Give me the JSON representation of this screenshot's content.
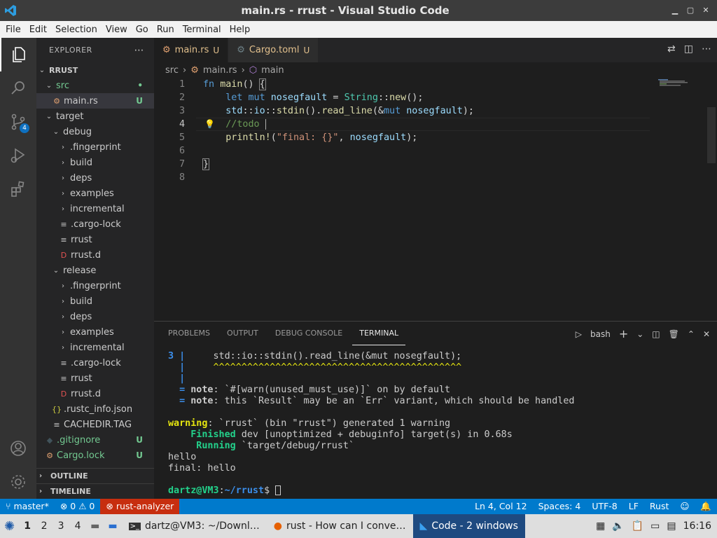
{
  "window": {
    "title": "main.rs - rrust - Visual Studio Code"
  },
  "menu": [
    "File",
    "Edit",
    "Selection",
    "View",
    "Go",
    "Run",
    "Terminal",
    "Help"
  ],
  "activity": {
    "scm_badge": "4"
  },
  "explorer": {
    "header": "EXPLORER",
    "root": "RRUST",
    "items": [
      {
        "label": "src",
        "indent": 1,
        "type": "folder-open",
        "green": true,
        "tag": "•"
      },
      {
        "label": "main.rs",
        "indent": 2,
        "type": "file",
        "green": false,
        "tag": "U",
        "selected": true
      },
      {
        "label": "target",
        "indent": 1,
        "type": "folder-open"
      },
      {
        "label": "debug",
        "indent": 2,
        "type": "folder-open"
      },
      {
        "label": ".fingerprint",
        "indent": 3,
        "type": "folder"
      },
      {
        "label": "build",
        "indent": 3,
        "type": "folder"
      },
      {
        "label": "deps",
        "indent": 3,
        "type": "folder"
      },
      {
        "label": "examples",
        "indent": 3,
        "type": "folder"
      },
      {
        "label": "incremental",
        "indent": 3,
        "type": "folder"
      },
      {
        "label": ".cargo-lock",
        "indent": 3,
        "type": "lines"
      },
      {
        "label": "rrust",
        "indent": 3,
        "type": "lines"
      },
      {
        "label": "rrust.d",
        "indent": 3,
        "type": "d"
      },
      {
        "label": "release",
        "indent": 2,
        "type": "folder-open"
      },
      {
        "label": ".fingerprint",
        "indent": 3,
        "type": "folder"
      },
      {
        "label": "build",
        "indent": 3,
        "type": "folder"
      },
      {
        "label": "deps",
        "indent": 3,
        "type": "folder"
      },
      {
        "label": "examples",
        "indent": 3,
        "type": "folder"
      },
      {
        "label": "incremental",
        "indent": 3,
        "type": "folder"
      },
      {
        "label": ".cargo-lock",
        "indent": 3,
        "type": "lines"
      },
      {
        "label": "rrust",
        "indent": 3,
        "type": "lines"
      },
      {
        "label": "rrust.d",
        "indent": 3,
        "type": "d"
      },
      {
        "label": ".rustc_info.json",
        "indent": 2,
        "type": "json"
      },
      {
        "label": "CACHEDIR.TAG",
        "indent": 2,
        "type": "lines"
      },
      {
        "label": ".gitignore",
        "indent": 1,
        "type": "git",
        "green": true,
        "tag": "U"
      },
      {
        "label": "Cargo.lock",
        "indent": 1,
        "type": "lock",
        "green": true,
        "tag": "U"
      }
    ],
    "outline": "OUTLINE",
    "timeline": "TIMELINE"
  },
  "tabs": [
    {
      "label": "main.rs",
      "status": "U",
      "active": true
    },
    {
      "label": "Cargo.toml",
      "status": "U",
      "active": false
    }
  ],
  "breadcrumb": [
    "src",
    "main.rs",
    "main"
  ],
  "editor": {
    "line_numbers": [
      "1",
      "2",
      "3",
      "4",
      "5",
      "6",
      "7",
      "8"
    ],
    "current_line": 4
  },
  "panel": {
    "tabs": [
      "PROBLEMS",
      "OUTPUT",
      "DEBUG CONSOLE",
      "TERMINAL"
    ],
    "active_tab": "TERMINAL",
    "shell": "bash",
    "terminal_lines": [
      "3 |     std::io::stdin().read_line(&mut nosegfault);",
      "  |     ^^^^^^^^^^^^^^^^^^^^^^^^^^^^^^^^^^^^^^^^^^^^",
      "  |",
      "  = note: `#[warn(unused_must_use)]` on by default",
      "  = note: this `Result` may be an `Err` variant, which should be handled",
      "",
      "warning: `rrust` (bin \"rrust\") generated 1 warning",
      "    Finished dev [unoptimized + debuginfo] target(s) in 0.68s",
      "     Running `target/debug/rrust`",
      "hello",
      "final: hello",
      "",
      "dartz@VM3:~/rrust$ "
    ]
  },
  "status": {
    "branch": "master*",
    "errors": "0",
    "warnings": "0",
    "analyzer": "rust-analyzer",
    "position": "Ln 4, Col 12",
    "spaces": "Spaces: 4",
    "encoding": "UTF-8",
    "eol": "LF",
    "language": "Rust"
  },
  "taskbar": {
    "workspaces": [
      "1",
      "2",
      "3",
      "4"
    ],
    "windows": [
      {
        "label": "dartz@VM3: ~/Downl…",
        "icon": "terminal-icon"
      },
      {
        "label": "rust - How can I conve…",
        "icon": "firefox-icon"
      },
      {
        "label": "Code - 2 windows",
        "icon": "vscode-icon",
        "active": true
      }
    ],
    "clock": "16:16"
  }
}
